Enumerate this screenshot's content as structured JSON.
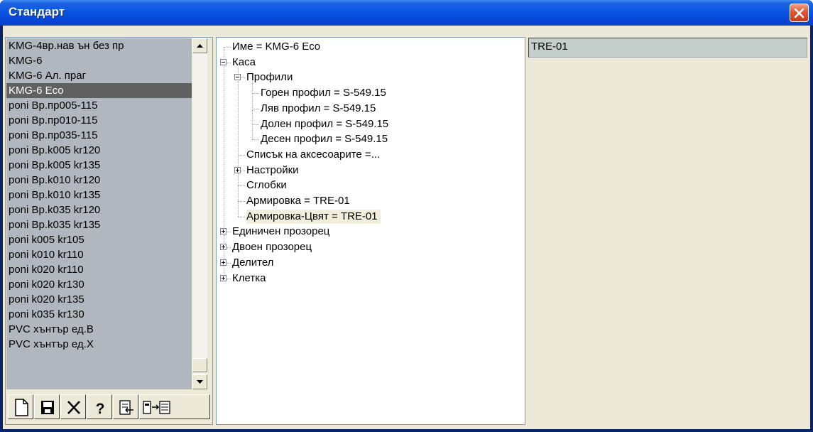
{
  "window": {
    "title": "Стандарт",
    "close_icon": "close-icon"
  },
  "list": {
    "items": [
      "KMG-4вр.нав ън без пр",
      "KMG-6",
      "KMG-6 Ал. праг",
      "KMG-6 Eco",
      "poni Вр.пр005-115",
      "poni Вр.пр010-115",
      "poni Вр.пр035-115",
      "poni Вр.k005 kr120",
      "poni Вр.k005 kr135",
      "poni Вр.k010 kr120",
      "poni Вр.k010 kr135",
      "poni Вр.k035 kr120",
      "poni Вр.k035 kr135",
      "poni k005 kr105",
      "poni k010 kr110",
      "poni k020 kr110",
      "poni k020 kr130",
      "poni k020 kr135",
      "poni k035 kr130",
      "PVC хънтър ед.В",
      "PVC хънтър ед.Х"
    ],
    "selected_index": 3
  },
  "toolbar": {
    "buttons": [
      "new-icon",
      "save-icon",
      "delete-icon",
      "help-icon",
      "import-icon",
      "export-icon"
    ],
    "help_label": "?"
  },
  "tree": {
    "nodes": [
      {
        "label": "Име  = KMG-6 Eco"
      },
      {
        "label": "Каса"
      },
      {
        "label": "Профили"
      },
      {
        "label": "Горен профил  = S-549.15"
      },
      {
        "label": "Ляв профил  = S-549.15"
      },
      {
        "label": "Долен профил  = S-549.15"
      },
      {
        "label": "Десен профил  = S-549.15"
      },
      {
        "label": "Списък на аксесоарите =..."
      },
      {
        "label": "Настройки"
      },
      {
        "label": "Сглобки"
      },
      {
        "label": "Армировка  = TRE-01"
      },
      {
        "label": "Армировка-Цвят  = TRE-01"
      },
      {
        "label": "Единичен прозорец"
      },
      {
        "label": "Двоен прозорец"
      },
      {
        "label": "Делител"
      },
      {
        "label": "Клетка"
      }
    ],
    "selected_index": 11
  },
  "right_field": {
    "value": "TRE-01"
  },
  "colors": {
    "titlebar": "#0a55e4",
    "list_background": "#b0b7be",
    "list_selected": "#606060",
    "field_background": "#c4cfcb",
    "client_background": "#ece9d8"
  }
}
